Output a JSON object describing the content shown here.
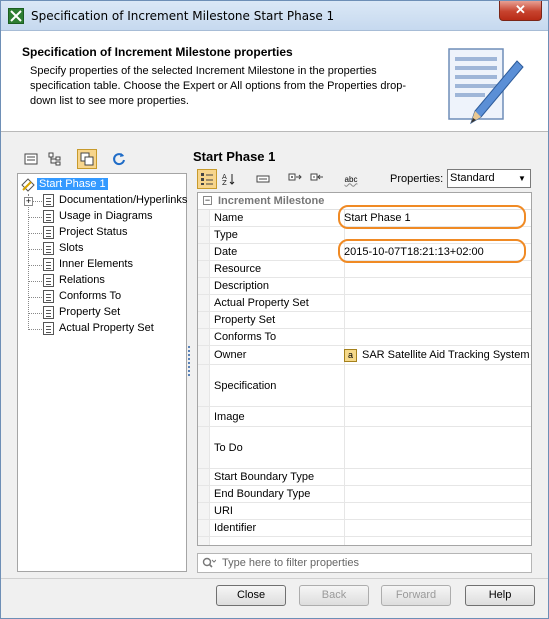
{
  "window": {
    "title": "Specification of Increment Milestone Start Phase 1",
    "close_glyph": "✕"
  },
  "header": {
    "title": "Specification of Increment Milestone properties",
    "description": "Specify properties of the selected Increment Milestone in the properties specification table. Choose the Expert or All options from the Properties drop-down list to see more properties."
  },
  "tree": {
    "root": "Start Phase 1",
    "items": [
      {
        "label": "Documentation/Hyperlinks",
        "expandable": true
      },
      {
        "label": "Usage in Diagrams"
      },
      {
        "label": "Project Status"
      },
      {
        "label": "Slots"
      },
      {
        "label": "Inner Elements"
      },
      {
        "label": "Relations"
      },
      {
        "label": "Conforms To"
      },
      {
        "label": "Property Set"
      },
      {
        "label": "Actual Property Set"
      }
    ]
  },
  "spec": {
    "title": "Start Phase 1",
    "properties_label": "Properties:",
    "properties_value": "Standard",
    "sort_icon_text": "abc"
  },
  "table": {
    "group": "Increment Milestone",
    "rows": [
      {
        "name": "Name",
        "value": "Start Phase 1"
      },
      {
        "name": "Type",
        "value": ""
      },
      {
        "name": "Date",
        "value": "2015-10-07T18:21:13+02:00"
      },
      {
        "name": "Resource",
        "value": ""
      },
      {
        "name": "Description",
        "value": ""
      },
      {
        "name": "Actual Property Set",
        "value": ""
      },
      {
        "name": "Property Set",
        "value": ""
      },
      {
        "name": "Conforms To",
        "value": ""
      },
      {
        "name": "Owner",
        "value": "SAR Satellite Aid Tracking System"
      },
      {
        "name": "Specification",
        "value": ""
      },
      {
        "name": "Image",
        "value": ""
      },
      {
        "name": "To Do",
        "value": ""
      },
      {
        "name": "Start Boundary Type",
        "value": ""
      },
      {
        "name": "End Boundary Type",
        "value": ""
      },
      {
        "name": "URI",
        "value": ""
      },
      {
        "name": "Identifier",
        "value": ""
      }
    ],
    "owner_icon_letter": "a"
  },
  "filter": {
    "placeholder": "Type here to filter properties",
    "icon_glyph": "🔍"
  },
  "buttons": {
    "close": "Close",
    "back": "Back",
    "forward": "Forward",
    "help": "Help"
  }
}
